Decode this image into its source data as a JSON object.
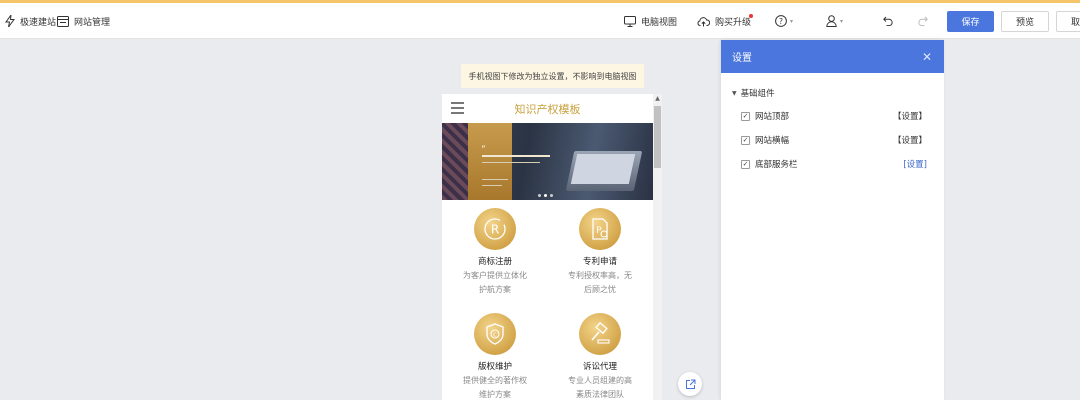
{
  "topbar": {
    "quick_build": "极速建站",
    "site_manage": "网站管理",
    "desktop_view": "电脑视图",
    "buy_upgrade": "购买升级",
    "save": "保存",
    "preview": "预览",
    "last_button": "取"
  },
  "notice": "手机视图下修改为独立设置，不影响到电脑视图",
  "phone": {
    "title": "知识产权模板",
    "services": [
      {
        "title": "商标注册",
        "desc": "为客户提供立体化护航方案",
        "icon": "trademark-r-icon"
      },
      {
        "title": "专利申请",
        "desc": "专利授权率高，无后顾之忧",
        "icon": "patent-certificate-icon"
      },
      {
        "title": "版权维护",
        "desc": "提供健全的著作权维护方案",
        "icon": "copyright-shield-icon"
      },
      {
        "title": "诉讼代理",
        "desc": "专业人员组建的高素质法律团队",
        "icon": "gavel-icon"
      }
    ]
  },
  "panel": {
    "title": "设置",
    "group": "基础组件",
    "items": [
      {
        "name": "网站顶部",
        "action": "【设置】",
        "checked": true
      },
      {
        "name": "网站横幅",
        "action": "【设置】",
        "checked": true
      },
      {
        "name": "底部服务栏",
        "action": "[设置]",
        "checked": true
      }
    ]
  },
  "colors": {
    "accent": "#4a76dd",
    "gold": "#d3a54a",
    "notice_bg": "#fdf6e3",
    "canvas_bg": "#eaebef"
  }
}
